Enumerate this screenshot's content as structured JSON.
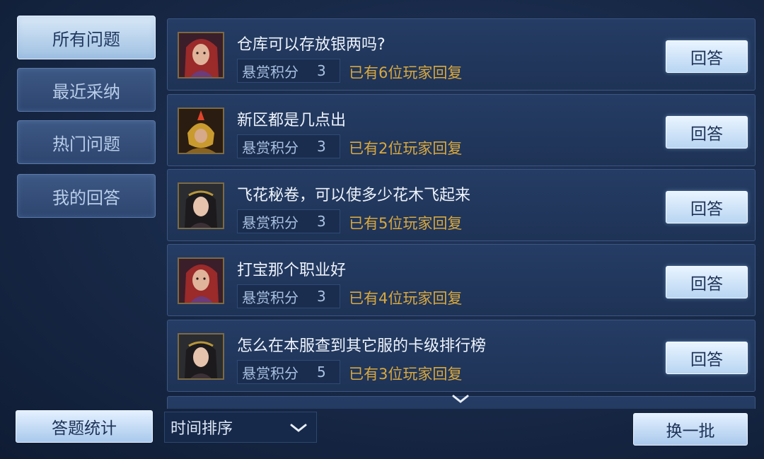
{
  "sidebar": {
    "tabs": [
      {
        "label": "所有问题",
        "active": true
      },
      {
        "label": "最近采纳",
        "active": false
      },
      {
        "label": "热门问题",
        "active": false
      },
      {
        "label": "我的回答",
        "active": false
      }
    ]
  },
  "questions": [
    {
      "title": "仓库可以存放银两吗?",
      "reward_label": "悬赏积分",
      "reward": "3",
      "replies": "已有6位玩家回复",
      "answer_label": "回答",
      "avatar": "red-hair-warrior"
    },
    {
      "title": "新区都是几点出",
      "reward_label": "悬赏积分",
      "reward": "3",
      "replies": "已有2位玩家回复",
      "answer_label": "回答",
      "avatar": "golden-helmet"
    },
    {
      "title": "飞花秘卷，可以使多少花木飞起来",
      "reward_label": "悬赏积分",
      "reward": "3",
      "replies": "已有5位玩家回复",
      "answer_label": "回答",
      "avatar": "dark-hair-heroine"
    },
    {
      "title": "打宝那个职业好",
      "reward_label": "悬赏积分",
      "reward": "3",
      "replies": "已有4位玩家回复",
      "answer_label": "回答",
      "avatar": "red-hair-warrior"
    },
    {
      "title": "怎么在本服查到其它服的卡级排行榜",
      "reward_label": "悬赏积分",
      "reward": "5",
      "replies": "已有3位玩家回复",
      "answer_label": "回答",
      "avatar": "dark-hair-heroine"
    }
  ],
  "footer": {
    "stats_label": "答题统计",
    "sort_value": "时间排序",
    "refresh_label": "换一批"
  },
  "colors": {
    "accent_gold": "#d9a83f",
    "button_light": "#e4f0ff",
    "panel": "#1e3356"
  }
}
